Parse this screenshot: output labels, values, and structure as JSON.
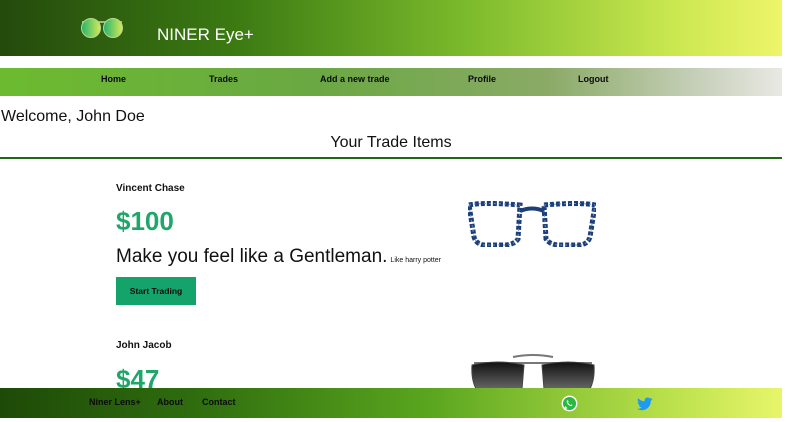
{
  "header": {
    "brand": "NINER Eye+",
    "logo_icon": "glasses-logo-icon"
  },
  "nav": {
    "items": [
      "Home",
      "Trades",
      "Add a new trade",
      "Profile",
      "Logout"
    ]
  },
  "welcome": "Welcome, John Doe",
  "section_title": "Your Trade Items",
  "items": [
    {
      "seller": "Vincent Chase",
      "price": "$100",
      "description": "Make you feel like a Gentleman.",
      "note": "Like harry potter",
      "button": "Start Trading",
      "image_icon": "blue-tortoise-eyeglasses-image"
    },
    {
      "seller": "John Jacob",
      "price": "$47",
      "image_icon": "aviator-sunglasses-image"
    }
  ],
  "footer": {
    "links": [
      "Niner Lens+",
      "About",
      "Contact"
    ],
    "icons": [
      "whatsapp-icon",
      "twitter-icon"
    ]
  },
  "colors": {
    "price": "#1fa66a",
    "button": "#14a36b",
    "rule": "#1d6a12"
  }
}
